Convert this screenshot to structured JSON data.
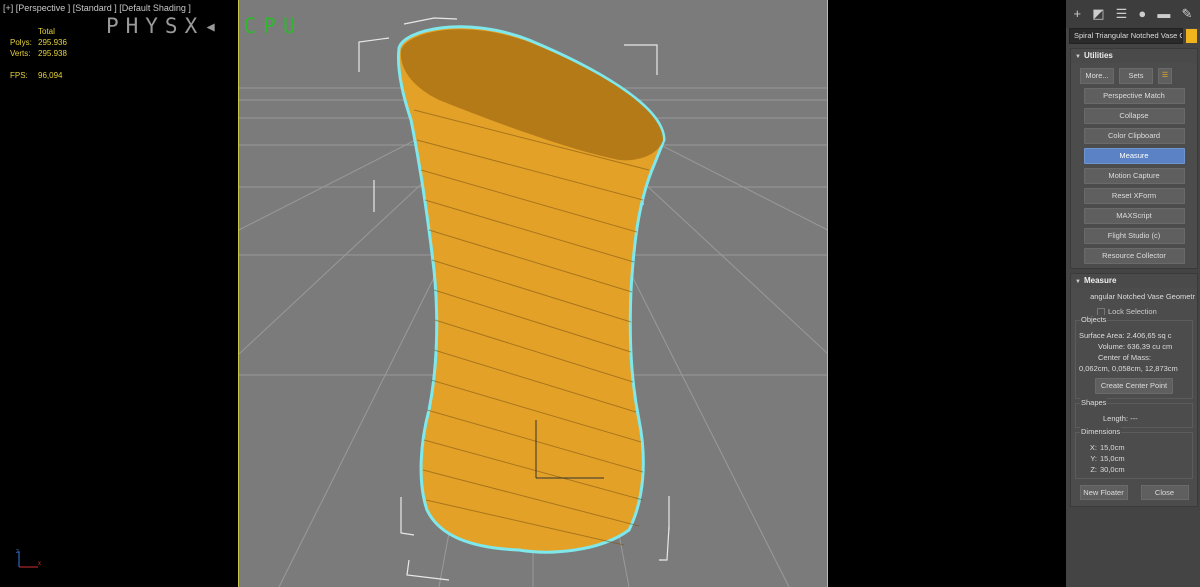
{
  "viewport": {
    "label": "[+] [Perspective ] [Standard ] [Default Shading ]",
    "stats": {
      "total_header": "Total",
      "polys_label": "Polys:",
      "polys_value": "295.936",
      "verts_label": "Verts:",
      "verts_value": "295.938",
      "fps_label": "FPS:",
      "fps_value": "96,094"
    },
    "physx_part1": "PHYSX",
    "physx_part2": "CPU",
    "axis_labels": {
      "z": "z",
      "x": "x"
    },
    "colors": {
      "grid": "#9a9a9a",
      "background": "#7b7b7b",
      "object": "#e3a128",
      "selection_outline": "#7ee8ec",
      "viewport_border": "#c7c64a"
    }
  },
  "command_panel": {
    "tab_icons": [
      "create-icon",
      "modify-icon",
      "hierarchy-icon",
      "motion-icon",
      "display-icon",
      "utilities-icon"
    ],
    "object_name": "Spiral Triangular Notched Vase G",
    "object_color": "#f0b41e",
    "utilities": {
      "title": "Utilities",
      "more_label": "More...",
      "sets_label": "Sets",
      "buttons": [
        "Perspective Match",
        "Collapse",
        "Color Clipboard",
        "Measure",
        "Motion Capture",
        "Reset XForm",
        "MAXScript",
        "Flight Studio (c)",
        "Resource Collector"
      ],
      "active_button": "Measure",
      "active_color": "#5a82c4"
    },
    "measure": {
      "title": "Measure",
      "object_name": "angular Notched Vase Geometr",
      "lock_selection": "Lock Selection",
      "objects_title": "Objects",
      "surface_area": "Surface Area: 2.406,65 sq c",
      "volume": "Volume: 636,39 cu cm",
      "center_of_mass_label": "Center of Mass:",
      "center_of_mass_value": "0,062cm, 0,058cm, 12,873cm",
      "create_center_point": "Create Center Point",
      "shapes_title": "Shapes",
      "length": "Length: ---",
      "dimensions_title": "Dimensions",
      "dim_x_label": "X:",
      "dim_x_value": "15,0cm",
      "dim_y_label": "Y:",
      "dim_y_value": "15,0cm",
      "dim_z_label": "Z:",
      "dim_z_value": "30,0cm",
      "new_floater": "New Floater",
      "close": "Close"
    }
  }
}
